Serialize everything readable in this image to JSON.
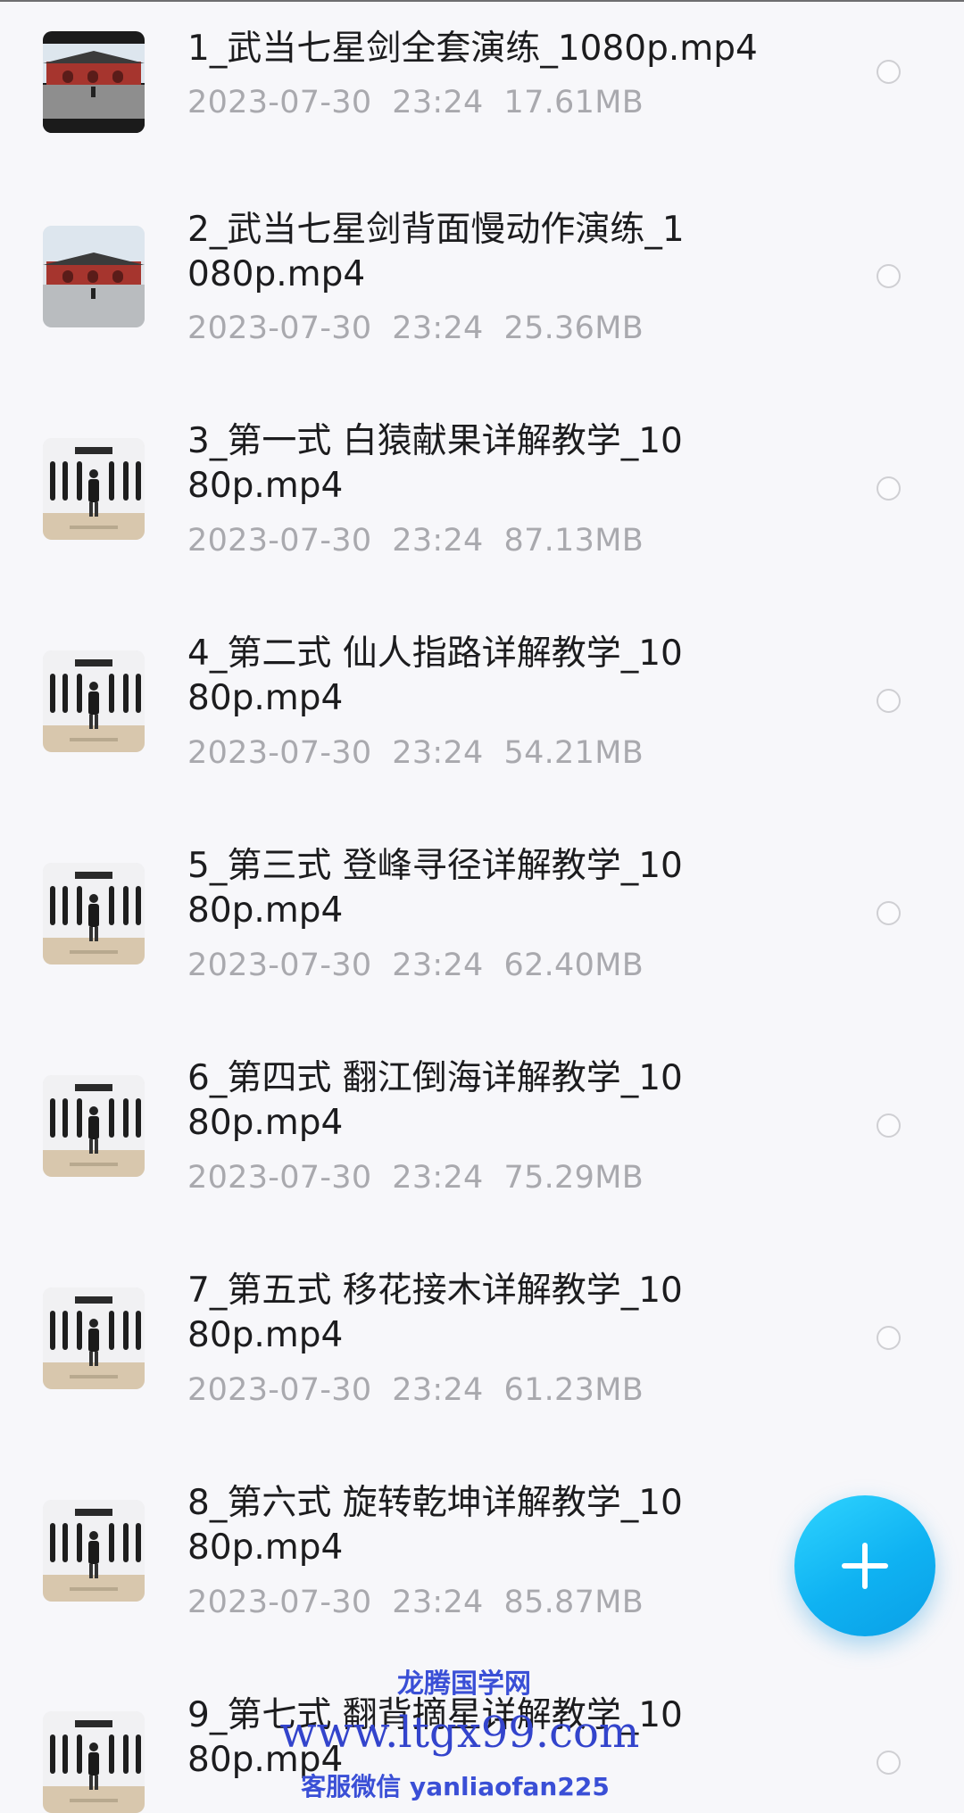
{
  "files": [
    {
      "name": "1_武当七星剑全套演练_1080p.mp4",
      "date": "2023-07-30",
      "time": "23:24",
      "size": "17.61MB",
      "thumb": "temple-dark"
    },
    {
      "name": "2_武当七星剑背面慢动作演练_1080p.mp4",
      "date": "2023-07-30",
      "time": "23:24",
      "size": "25.36MB",
      "thumb": "temple-square"
    },
    {
      "name": "3_第一式 白猿献果详解教学_1080p.mp4",
      "date": "2023-07-30",
      "time": "23:24",
      "size": "87.13MB",
      "thumb": "studio-tutorial"
    },
    {
      "name": "4_第二式 仙人指路详解教学_1080p.mp4",
      "date": "2023-07-30",
      "time": "23:24",
      "size": "54.21MB",
      "thumb": "studio-tutorial"
    },
    {
      "name": "5_第三式 登峰寻径详解教学_1080p.mp4",
      "date": "2023-07-30",
      "time": "23:24",
      "size": "62.40MB",
      "thumb": "studio-tutorial"
    },
    {
      "name": "6_第四式 翻江倒海详解教学_1080p.mp4",
      "date": "2023-07-30",
      "time": "23:24",
      "size": "75.29MB",
      "thumb": "studio-tutorial"
    },
    {
      "name": "7_第五式 移花接木详解教学_1080p.mp4",
      "date": "2023-07-30",
      "time": "23:24",
      "size": "61.23MB",
      "thumb": "studio-tutorial"
    },
    {
      "name": "8_第六式 旋转乾坤详解教学_1080p.mp4",
      "date": "2023-07-30",
      "time": "23:24",
      "size": "85.87MB",
      "thumb": "studio-tutorial"
    },
    {
      "name": "9_第七式 翻背摘星详解教学_1080p.mp4",
      "date": "",
      "time": "",
      "size": "",
      "thumb": "studio-tutorial"
    }
  ],
  "fab": {
    "icon": "plus-icon",
    "color": "#1bbcf5"
  },
  "watermark": {
    "line1": "龙腾国学网",
    "line2": "www.ltgx99.com",
    "line3": "客服微信 yanliaofan225"
  }
}
